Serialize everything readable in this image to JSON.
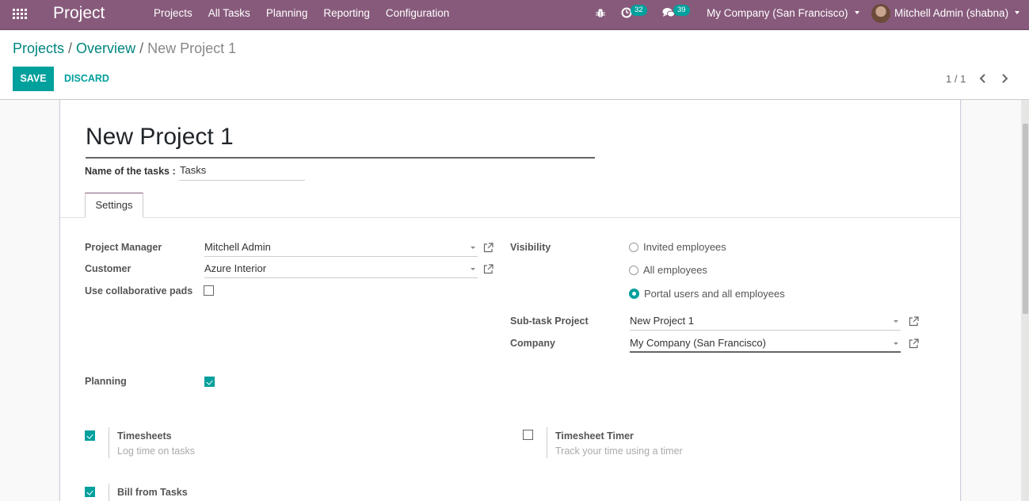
{
  "navbar": {
    "app_title": "Project",
    "menu": [
      "Projects",
      "All Tasks",
      "Planning",
      "Reporting",
      "Configuration"
    ],
    "activity_count": "32",
    "message_count": "39",
    "company": "My Company (San Francisco)",
    "user": "Mitchell Admin (shabna)"
  },
  "breadcrumb": {
    "items": [
      "Projects",
      "Overview"
    ],
    "separator": "/",
    "current": "New Project 1"
  },
  "buttons": {
    "save": "SAVE",
    "discard": "DISCARD"
  },
  "pager": {
    "value": "1 / 1"
  },
  "form": {
    "name": "New Project 1",
    "tasks_label": "Name of the tasks :",
    "tasks_value": "Tasks",
    "tabs": [
      "Settings"
    ],
    "project_manager_label": "Project Manager",
    "project_manager_value": "Mitchell Admin",
    "customer_label": "Customer",
    "customer_value": "Azure Interior",
    "collab_pads_label": "Use collaborative pads",
    "collab_pads_checked": false,
    "visibility_label": "Visibility",
    "visibility_options": [
      "Invited employees",
      "All employees",
      "Portal users and all employees"
    ],
    "visibility_selected": "Portal users and all employees",
    "subtask_label": "Sub-task Project",
    "subtask_value": "New Project 1",
    "company_label": "Company",
    "company_value": "My Company (San Francisco)",
    "planning_label": "Planning",
    "planning_checked": true,
    "settings": [
      {
        "title": "Timesheets",
        "description": "Log time on tasks",
        "checked": true
      },
      {
        "title": "Timesheet Timer",
        "description": "Track your time using a timer",
        "checked": false
      },
      {
        "title": "Bill from Tasks",
        "description": "",
        "checked": true
      }
    ]
  },
  "colors": {
    "brand": "#875a7b",
    "accent": "#00a09d",
    "link": "#00857f"
  }
}
